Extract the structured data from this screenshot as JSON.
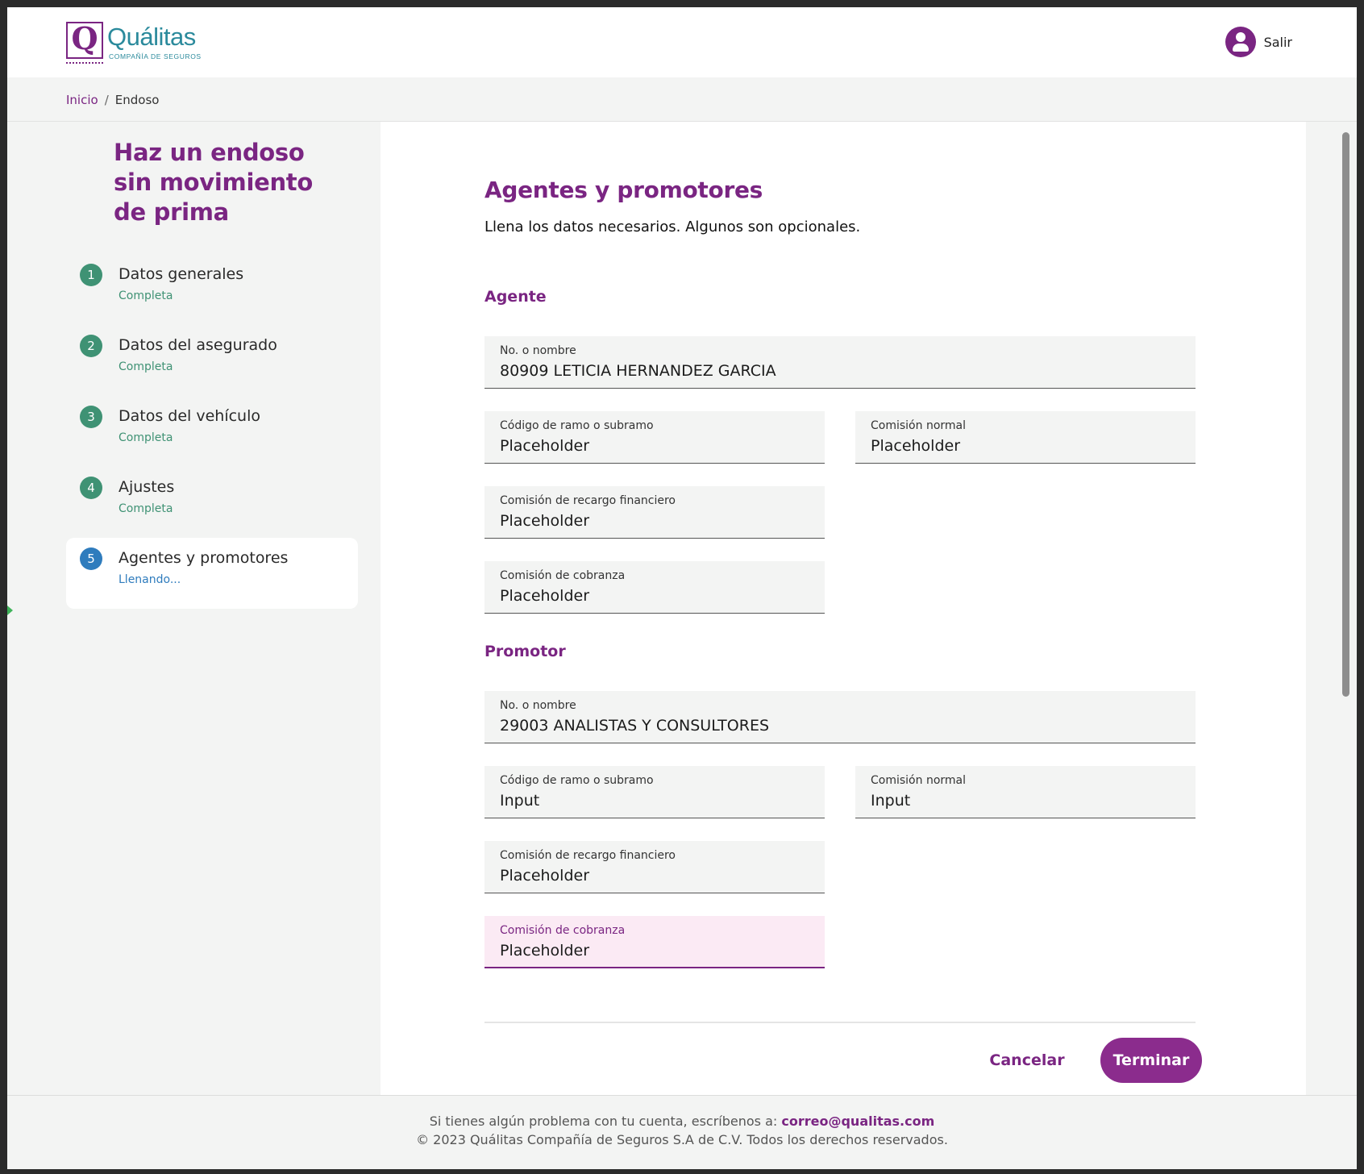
{
  "brand": {
    "name": "Quálitas",
    "subtitle": "COMPAÑÍA DE SEGUROS",
    "mark": "Q"
  },
  "header": {
    "user_label": "Salir"
  },
  "breadcrumb": {
    "home": "Inicio",
    "separator": "/",
    "current": "Endoso"
  },
  "sidebar": {
    "title": "Haz un endoso sin movimiento de prima",
    "steps": [
      {
        "number": "1",
        "label": "Datos generales",
        "status": "Completa"
      },
      {
        "number": "2",
        "label": "Datos del asegurado",
        "status": "Completa"
      },
      {
        "number": "3",
        "label": "Datos del vehículo",
        "status": "Completa"
      },
      {
        "number": "4",
        "label": "Ajustes",
        "status": "Completa"
      },
      {
        "number": "5",
        "label": "Agentes y promotores",
        "status": "Llenando..."
      }
    ]
  },
  "main": {
    "title": "Agentes y promotores",
    "intro": "Llena los datos necesarios. Algunos son opcionales.",
    "agente": {
      "heading": "Agente",
      "fields": {
        "nombre": {
          "label": "No. o nombre",
          "value": "80909 LETICIA HERNANDEZ GARCIA"
        },
        "codigo": {
          "label": "Código de ramo o subramo",
          "value": "Placeholder"
        },
        "comision_normal": {
          "label": "Comisión normal",
          "value": "Placeholder"
        },
        "recargo": {
          "label": "Comisión de recargo financiero",
          "value": "Placeholder"
        },
        "cobranza": {
          "label": "Comisión de cobranza",
          "value": "Placeholder"
        }
      }
    },
    "promotor": {
      "heading": "Promotor",
      "fields": {
        "nombre": {
          "label": "No. o nombre",
          "value": "29003 ANALISTAS Y CONSULTORES"
        },
        "codigo": {
          "label": "Código de ramo o subramo",
          "value": "Input"
        },
        "comision_normal": {
          "label": "Comisión normal",
          "value": "Input"
        },
        "recargo": {
          "label": "Comisión de recargo financiero",
          "value": "Placeholder"
        },
        "cobranza": {
          "label": "Comisión de cobranza",
          "value": "Placeholder"
        }
      }
    },
    "actions": {
      "cancel": "Cancelar",
      "finish": "Terminar"
    }
  },
  "footer": {
    "help_text": "Si tienes algún problema con tu cuenta, escríbenos a:",
    "email": "correo@qualitas.com",
    "copyright": "© 2023 Quálitas Compañía de Seguros S.A de C.V. Todos los derechos reservados."
  },
  "colors": {
    "brand_purple": "#7a2582",
    "brand_teal": "#2b8a9c",
    "complete_green": "#3f9274",
    "active_blue": "#2f7cbd"
  },
  "icons": {
    "user": "user-circle-icon"
  }
}
